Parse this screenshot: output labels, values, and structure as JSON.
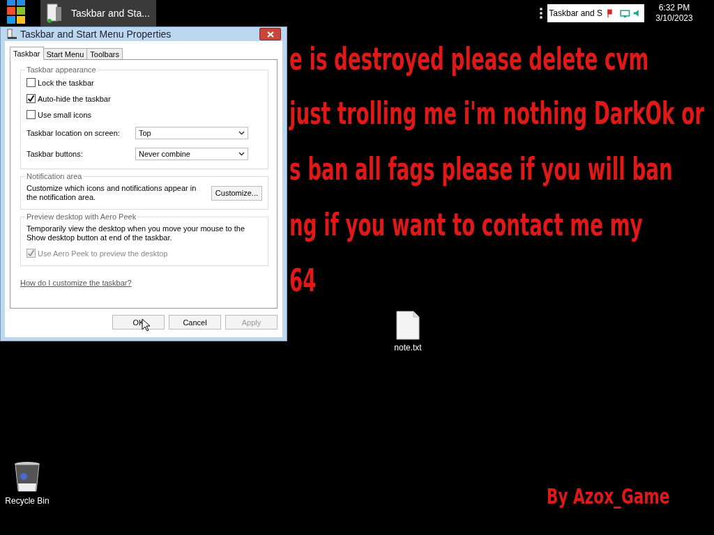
{
  "taskbar": {
    "buttons": [
      {
        "label": "Taskbar and Sta...",
        "selected": true
      }
    ],
    "tray": {
      "tooltip": "Taskbar and S",
      "time": "6:32 PM",
      "date": "3/10/2023"
    }
  },
  "wallpaper": {
    "lines": [
      "e is destroyed please delete cvm",
      "just trolling me i'm nothing DarkOk or",
      "s ban all fags please if you will ban",
      "ng if you want to contact me my",
      "64"
    ],
    "signature": "By Azox_Game"
  },
  "desktop_icons": [
    {
      "label": "note.txt",
      "kind": "file"
    },
    {
      "label": "Recycle Bin",
      "kind": "bin"
    }
  ],
  "dialog": {
    "title": "Taskbar and Start Menu Properties",
    "tabs": [
      {
        "label": "Taskbar",
        "selected": true
      },
      {
        "label": "Start Menu",
        "selected": false
      },
      {
        "label": "Toolbars",
        "selected": false
      }
    ],
    "appearance": {
      "legend": "Taskbar appearance",
      "checkboxes": [
        {
          "label": "Lock the taskbar",
          "checked": false
        },
        {
          "label": "Auto-hide the taskbar",
          "checked": true
        },
        {
          "label": "Use small icons",
          "checked": false
        }
      ],
      "selects": [
        {
          "label": "Taskbar location on screen:",
          "value": "Top"
        },
        {
          "label": "Taskbar buttons:",
          "value": "Never combine"
        }
      ]
    },
    "notification": {
      "legend": "Notification area",
      "text": "Customize which icons and notifications appear in the notification area.",
      "button": "Customize..."
    },
    "peek": {
      "legend": "Preview desktop with Aero Peek",
      "text": "Temporarily view the desktop when you move your mouse to the Show desktop button at end of the taskbar.",
      "checkbox": {
        "label": "Use Aero Peek to preview the desktop",
        "checked": true,
        "disabled": true
      }
    },
    "link": "How do I customize the taskbar?",
    "buttons": [
      {
        "label": "OK",
        "disabled": false
      },
      {
        "label": "Cancel",
        "disabled": false
      },
      {
        "label": "Apply",
        "disabled": true
      }
    ]
  }
}
